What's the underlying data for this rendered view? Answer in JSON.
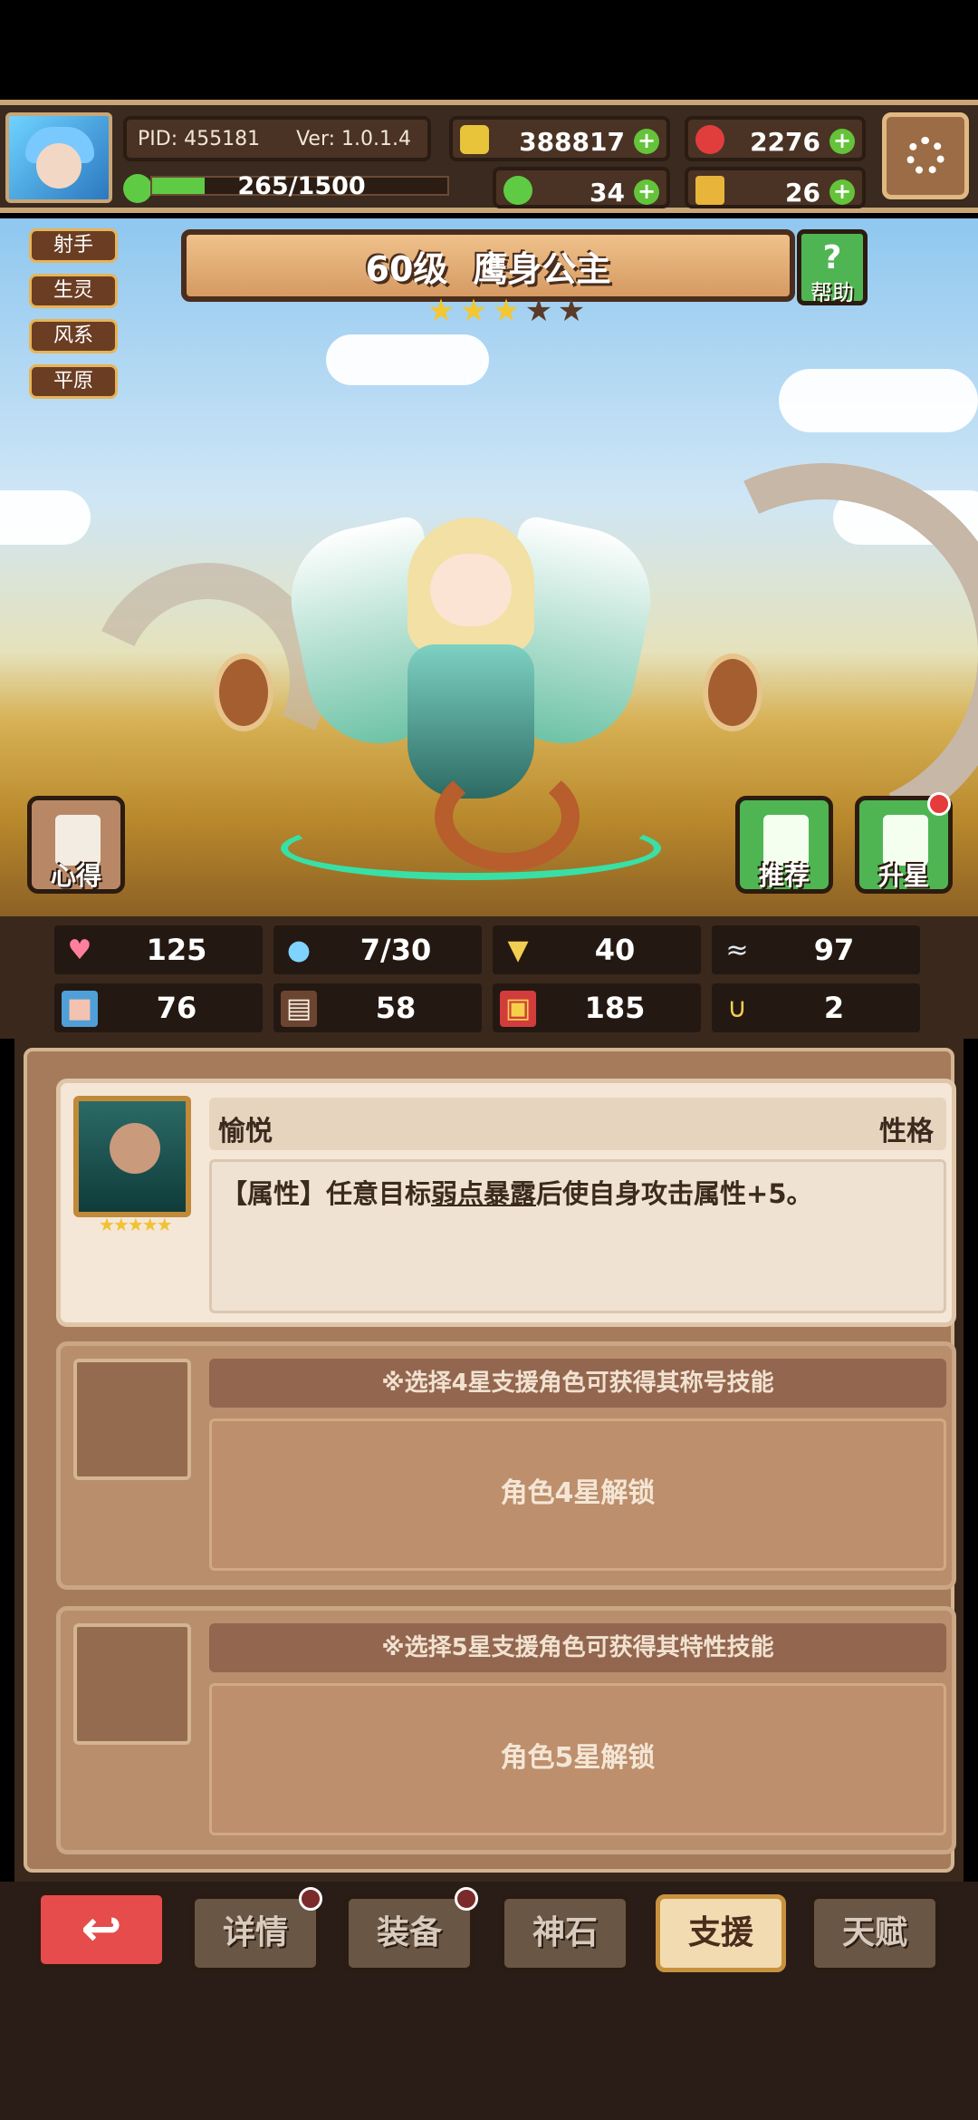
{
  "header": {
    "pid": "PID: 455181",
    "version": "Ver: 1.0.1.4",
    "coins": "388817",
    "gems": "2276",
    "exp_text": "265/1500",
    "exp_fraction": 0.177,
    "clovers": "34",
    "keys": "26"
  },
  "character": {
    "level": "60级",
    "name": "鹰身公主",
    "stars_filled": 3,
    "stars_total": 5,
    "tags": [
      "射手",
      "生灵",
      "风系",
      "平原"
    ],
    "help_label": "帮助",
    "left_button": "心得",
    "recommend_button": "推荐",
    "upgrade_button": "升星"
  },
  "stats": [
    {
      "icon": "heart-icon",
      "value": "125"
    },
    {
      "icon": "water-drop-icon",
      "value": "7/30"
    },
    {
      "icon": "shield-icon",
      "value": "40"
    },
    {
      "icon": "wing-icon",
      "value": "97"
    },
    {
      "icon": "fist-icon",
      "value": "76"
    },
    {
      "icon": "book-icon",
      "value": "58"
    },
    {
      "icon": "spellbook-icon",
      "value": "185"
    },
    {
      "icon": "horseshoe-icon",
      "value": "2"
    }
  ],
  "support": {
    "card": {
      "name": "愉悦",
      "tag": "性格",
      "desc_prefix": "【属性】任意目标",
      "desc_link": "弱点暴露",
      "desc_suffix": "后使自身攻击属性+5。"
    },
    "slot4_hint": "※选择4星支援角色可获得其称号技能",
    "slot4_lock": "角色4星解锁",
    "slot5_hint": "※选择5星支援角色可获得其特性技能",
    "slot5_lock": "角色5星解锁"
  },
  "nav": [
    "详情",
    "装备",
    "神石",
    "支援",
    "天赋"
  ],
  "nav_active": "支援"
}
